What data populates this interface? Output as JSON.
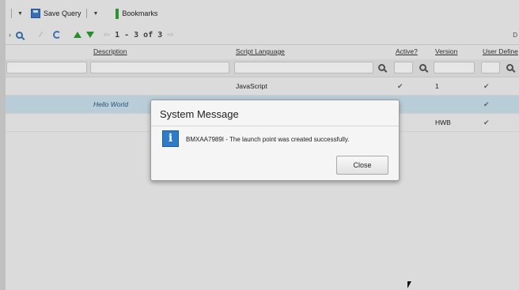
{
  "toolbar": {
    "left_fragment": "h",
    "save_query_label": "Save Query",
    "bookmarks_label": "Bookmarks"
  },
  "toolbar2": {
    "left_fragment": "r",
    "page_info": "1 - 3 of 3",
    "right_fragment": "D"
  },
  "table": {
    "headers": {
      "description": "Description",
      "script_language": "Script Language",
      "active": "Active?",
      "version": "Version",
      "user_defined": "User Define"
    },
    "rows": [
      {
        "description": "",
        "script_language": "JavaScript",
        "active": "✔",
        "version": "1",
        "user_defined": "✔"
      },
      {
        "description": "Hello World",
        "script_language": "",
        "active": "",
        "version": "",
        "user_defined": "✔"
      },
      {
        "description": "",
        "script_language": "",
        "active": "",
        "version": "HWB",
        "user_defined": "✔"
      }
    ]
  },
  "dialog": {
    "title": "System Message",
    "icon": "info-icon",
    "icon_glyph": "i",
    "message": "BMXAA7989I - The launch point was created successfully.",
    "close_label": "Close"
  },
  "colors": {
    "selected_row": "#c8dde9",
    "info_icon": "#2d7cc9",
    "nav_arrows": "#2a9a2a"
  }
}
